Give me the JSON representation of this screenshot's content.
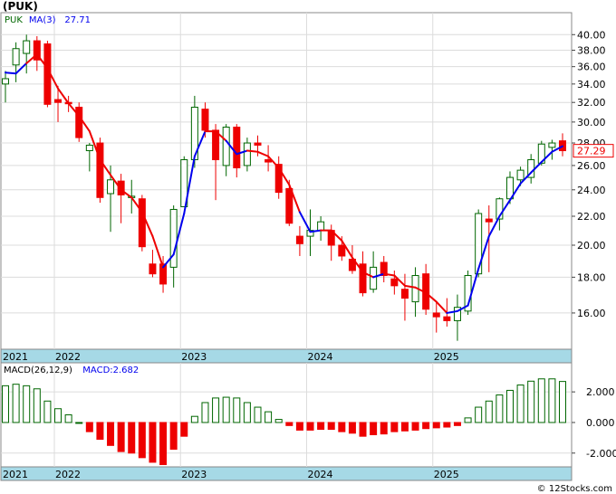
{
  "chart_data": {
    "type": "candlestick",
    "title": "(PUK)",
    "footer": "© 12Stocks.com",
    "colors": {
      "up": "#ffffff",
      "up_border": "#006600",
      "down": "#ee0000",
      "ma_down": "#ee0000",
      "ma_up": "#0000ee",
      "macd_up_border": "#006600",
      "macd_down": "#ee0000",
      "axis_band": "#a6d9e6",
      "grid": "#dcdcdc",
      "last_price_color": "#ee0000"
    },
    "price_panel": {
      "legend": [
        {
          "label": "PUK",
          "color": "#006600"
        },
        {
          "label": "MA(3)",
          "color": "#0000ee"
        },
        {
          "label": "27.71",
          "color": "#0000ee"
        }
      ],
      "scale": "log",
      "ylim": [
        14.2,
        43.0
      ],
      "ticks": [
        "40.00",
        "38.00",
        "36.00",
        "34.00",
        "32.00",
        "30.00",
        "28.00",
        "26.00",
        "24.00",
        "22.00",
        "20.00",
        "18.00",
        "16.00"
      ],
      "last_price": "27.29"
    },
    "macd_panel": {
      "legend": [
        {
          "label": "MACD(26,12,9)",
          "color": "#000000"
        },
        {
          "label": "MACD:2.682",
          "color": "#0000ee"
        }
      ],
      "ylim": [
        -2.9,
        3.9
      ],
      "ticks": [
        "2.000",
        "0.000",
        "-2.000"
      ]
    },
    "x_axis_labels": [
      {
        "label": "2021",
        "index": 0
      },
      {
        "label": "2022",
        "index": 5
      },
      {
        "label": "2023",
        "index": 17
      },
      {
        "label": "2024",
        "index": 29
      },
      {
        "label": "2025",
        "index": 41
      }
    ],
    "candles": [
      {
        "o": 34.0,
        "h": 35.5,
        "l": 32.0,
        "c": 34.6,
        "ma": 35.3,
        "ma_up": false,
        "macd": 2.4
      },
      {
        "o": 36.2,
        "h": 39.0,
        "l": 34.2,
        "c": 38.2,
        "ma": 35.2,
        "ma_up": true,
        "macd": 2.5
      },
      {
        "o": 37.6,
        "h": 40.0,
        "l": 35.2,
        "c": 39.2,
        "ma": 36.4,
        "ma_up": true,
        "macd": 2.4
      },
      {
        "o": 39.2,
        "h": 39.8,
        "l": 35.5,
        "c": 36.8,
        "ma": 37.5,
        "ma_up": false,
        "macd": 2.2
      },
      {
        "o": 38.8,
        "h": 39.2,
        "l": 31.5,
        "c": 31.8,
        "ma": 35.8,
        "ma_up": false,
        "macd": 1.4
      },
      {
        "o": 32.3,
        "h": 33.8,
        "l": 30.0,
        "c": 32.0,
        "ma": 33.5,
        "ma_up": false,
        "macd": 0.9
      },
      {
        "o": 32.0,
        "h": 32.7,
        "l": 31.0,
        "c": 31.9,
        "ma": 31.9,
        "ma_up": false,
        "macd": 0.5
      },
      {
        "o": 31.5,
        "h": 32.0,
        "l": 28.1,
        "c": 28.5,
        "ma": 30.6,
        "ma_up": false,
        "macd": 0.0
      },
      {
        "o": 27.3,
        "h": 28.0,
        "l": 25.5,
        "c": 27.8,
        "ma": 29.1,
        "ma_up": false,
        "macd": -0.6
      },
      {
        "o": 28.0,
        "h": 28.5,
        "l": 23.0,
        "c": 23.4,
        "ma": 26.5,
        "ma_up": false,
        "macd": -1.1
      },
      {
        "o": 23.7,
        "h": 26.0,
        "l": 20.9,
        "c": 24.8,
        "ma": 25.2,
        "ma_up": false,
        "macd": -1.5
      },
      {
        "o": 24.7,
        "h": 25.3,
        "l": 21.5,
        "c": 23.6,
        "ma": 24.0,
        "ma_up": false,
        "macd": -1.9
      },
      {
        "o": 23.5,
        "h": 24.8,
        "l": 22.2,
        "c": 23.5,
        "ma": 23.4,
        "ma_up": false,
        "macd": -2.0
      },
      {
        "o": 23.3,
        "h": 23.6,
        "l": 19.6,
        "c": 19.9,
        "ma": 22.3,
        "ma_up": false,
        "macd": -2.3
      },
      {
        "o": 18.8,
        "h": 19.7,
        "l": 18.0,
        "c": 18.2,
        "ma": 20.6,
        "ma_up": false,
        "macd": -2.6
      },
      {
        "o": 18.8,
        "h": 19.3,
        "l": 17.1,
        "c": 17.6,
        "ma": 18.6,
        "ma_up": false,
        "macd": -2.75
      },
      {
        "o": 18.6,
        "h": 22.8,
        "l": 17.4,
        "c": 22.5,
        "ma": 19.4,
        "ma_up": true,
        "macd": -1.75
      },
      {
        "o": 22.7,
        "h": 26.8,
        "l": 23.0,
        "c": 26.5,
        "ma": 22.2,
        "ma_up": true,
        "macd": -0.9
      },
      {
        "o": 26.5,
        "h": 32.7,
        "l": 25.8,
        "c": 31.5,
        "ma": 26.8,
        "ma_up": true,
        "macd": 0.4
      },
      {
        "o": 31.3,
        "h": 32.0,
        "l": 28.5,
        "c": 29.2,
        "ma": 29.1,
        "ma_up": true,
        "macd": 1.3
      },
      {
        "o": 29.2,
        "h": 29.8,
        "l": 23.2,
        "c": 26.5,
        "ma": 29.1,
        "ma_up": false,
        "macd": 1.6
      },
      {
        "o": 26.0,
        "h": 29.8,
        "l": 25.1,
        "c": 29.5,
        "ma": 28.2,
        "ma_up": false,
        "macd": 1.65
      },
      {
        "o": 29.5,
        "h": 29.8,
        "l": 25.0,
        "c": 25.8,
        "ma": 27.0,
        "ma_up": true,
        "macd": 1.6
      },
      {
        "o": 26.0,
        "h": 28.5,
        "l": 25.5,
        "c": 28.0,
        "ma": 27.3,
        "ma_up": true,
        "macd": 1.3
      },
      {
        "o": 28.0,
        "h": 28.7,
        "l": 26.8,
        "c": 27.8,
        "ma": 27.2,
        "ma_up": false,
        "macd": 1.0
      },
      {
        "o": 26.5,
        "h": 27.8,
        "l": 25.5,
        "c": 26.3,
        "ma": 26.8,
        "ma_up": false,
        "macd": 0.7
      },
      {
        "o": 26.1,
        "h": 26.8,
        "l": 23.3,
        "c": 23.8,
        "ma": 25.8,
        "ma_up": false,
        "macd": 0.2
      },
      {
        "o": 24.1,
        "h": 24.8,
        "l": 21.3,
        "c": 21.5,
        "ma": 24.4,
        "ma_up": false,
        "macd": -0.2
      },
      {
        "o": 20.6,
        "h": 21.3,
        "l": 19.3,
        "c": 20.1,
        "ma": 22.3,
        "ma_up": false,
        "macd": -0.5
      },
      {
        "o": 20.6,
        "h": 22.5,
        "l": 19.3,
        "c": 21.0,
        "ma": 20.9,
        "ma_up": true,
        "macd": -0.5
      },
      {
        "o": 21.0,
        "h": 22.0,
        "l": 20.3,
        "c": 21.6,
        "ma": 21.0,
        "ma_up": true,
        "macd": -0.45
      },
      {
        "o": 21.0,
        "h": 21.4,
        "l": 19.0,
        "c": 20.0,
        "ma": 21.0,
        "ma_up": false,
        "macd": -0.45
      },
      {
        "o": 20.0,
        "h": 20.6,
        "l": 19.0,
        "c": 19.3,
        "ma": 20.3,
        "ma_up": false,
        "macd": -0.6
      },
      {
        "o": 19.1,
        "h": 20.0,
        "l": 18.2,
        "c": 18.4,
        "ma": 19.2,
        "ma_up": false,
        "macd": -0.7
      },
      {
        "o": 18.8,
        "h": 19.6,
        "l": 16.9,
        "c": 17.1,
        "ma": 18.3,
        "ma_up": false,
        "macd": -0.9
      },
      {
        "o": 17.3,
        "h": 19.6,
        "l": 17.1,
        "c": 18.6,
        "ma": 18.0,
        "ma_up": false,
        "macd": -0.8
      },
      {
        "o": 18.9,
        "h": 19.3,
        "l": 17.7,
        "c": 18.1,
        "ma": 18.2,
        "ma_up": true,
        "macd": -0.75
      },
      {
        "o": 17.9,
        "h": 18.4,
        "l": 17.0,
        "c": 17.5,
        "ma": 18.1,
        "ma_up": false,
        "macd": -0.6
      },
      {
        "o": 17.3,
        "h": 18.2,
        "l": 15.6,
        "c": 16.8,
        "ma": 17.5,
        "ma_up": false,
        "macd": -0.55
      },
      {
        "o": 16.6,
        "h": 18.6,
        "l": 15.8,
        "c": 18.1,
        "ma": 17.4,
        "ma_up": false,
        "macd": -0.5
      },
      {
        "o": 18.2,
        "h": 18.8,
        "l": 15.9,
        "c": 16.2,
        "ma": 17.1,
        "ma_up": false,
        "macd": -0.4
      },
      {
        "o": 16.0,
        "h": 16.6,
        "l": 15.0,
        "c": 15.8,
        "ma": 16.6,
        "ma_up": false,
        "macd": -0.35
      },
      {
        "o": 15.8,
        "h": 16.8,
        "l": 15.3,
        "c": 15.6,
        "ma": 16.0,
        "ma_up": false,
        "macd": -0.3
      },
      {
        "o": 15.6,
        "h": 17.0,
        "l": 14.6,
        "c": 16.3,
        "ma": 16.1,
        "ma_up": true,
        "macd": -0.2
      },
      {
        "o": 16.1,
        "h": 18.4,
        "l": 15.9,
        "c": 18.1,
        "ma": 16.4,
        "ma_up": true,
        "macd": 0.3
      },
      {
        "o": 18.2,
        "h": 22.5,
        "l": 18.0,
        "c": 22.2,
        "ma": 18.5,
        "ma_up": true,
        "macd": 1.0
      },
      {
        "o": 21.8,
        "h": 22.8,
        "l": 18.3,
        "c": 21.6,
        "ma": 20.6,
        "ma_up": true,
        "macd": 1.4
      },
      {
        "o": 21.8,
        "h": 23.4,
        "l": 21.0,
        "c": 23.3,
        "ma": 22.0,
        "ma_up": true,
        "macd": 1.8
      },
      {
        "o": 23.3,
        "h": 25.5,
        "l": 22.9,
        "c": 25.0,
        "ma": 23.2,
        "ma_up": true,
        "macd": 2.1
      },
      {
        "o": 24.8,
        "h": 25.9,
        "l": 24.3,
        "c": 25.6,
        "ma": 24.5,
        "ma_up": true,
        "macd": 2.45
      },
      {
        "o": 25.0,
        "h": 27.0,
        "l": 24.5,
        "c": 26.5,
        "ma": 25.4,
        "ma_up": true,
        "macd": 2.7
      },
      {
        "o": 26.2,
        "h": 28.2,
        "l": 26.0,
        "c": 27.9,
        "ma": 26.3,
        "ma_up": true,
        "macd": 2.85
      },
      {
        "o": 27.6,
        "h": 28.3,
        "l": 26.5,
        "c": 28.0,
        "ma": 27.2,
        "ma_up": true,
        "macd": 2.85
      },
      {
        "o": 28.2,
        "h": 28.9,
        "l": 26.8,
        "c": 27.3,
        "ma": 27.7,
        "ma_up": true,
        "macd": 2.68
      }
    ]
  }
}
